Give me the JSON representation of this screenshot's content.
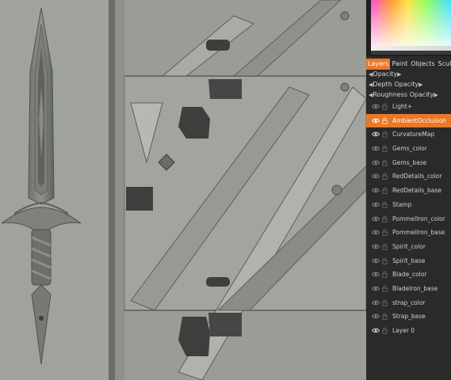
{
  "panel": {
    "tabs": [
      {
        "label": "Layers",
        "active": true
      },
      {
        "label": "Paint",
        "active": false
      },
      {
        "label": "Objects",
        "active": false
      },
      {
        "label": "Sculpt",
        "active": false
      }
    ],
    "properties": {
      "opacity": "Opacity",
      "depth": "Depth",
      "depth_opacity": "Opacity",
      "roughness": "Roughness",
      "roughness_opacity": "Opacity"
    },
    "layers": [
      {
        "name": "Light+",
        "visible": false,
        "active": false
      },
      {
        "name": "AmbientOcclusion",
        "visible": true,
        "active": true
      },
      {
        "name": "CurvatureMap",
        "visible": true,
        "active": false
      },
      {
        "name": "Gems_color",
        "visible": false,
        "active": false
      },
      {
        "name": "Gems_base",
        "visible": false,
        "active": false
      },
      {
        "name": "RedDetails_color",
        "visible": false,
        "active": false
      },
      {
        "name": "RedDetails_base",
        "visible": false,
        "active": false
      },
      {
        "name": "Stamp",
        "visible": false,
        "active": false
      },
      {
        "name": "PommelIron_color",
        "visible": false,
        "active": false
      },
      {
        "name": "PommelIron_base",
        "visible": false,
        "active": false
      },
      {
        "name": "Spirit_color",
        "visible": false,
        "active": false
      },
      {
        "name": "Spirit_base",
        "visible": false,
        "active": false
      },
      {
        "name": "Blade_color",
        "visible": false,
        "active": false
      },
      {
        "name": "BladeIron_base",
        "visible": false,
        "active": false
      },
      {
        "name": "strap_color",
        "visible": false,
        "active": false
      },
      {
        "name": "Strap_base",
        "visible": false,
        "active": false
      },
      {
        "name": "Layer 0",
        "visible": true,
        "active": false
      }
    ]
  },
  "colors": {
    "accent": "#e8782a",
    "panel_bg": "#2a2a2a",
    "viewport_bg": "#9fa29d",
    "uv_bg": "#8a8c88"
  }
}
